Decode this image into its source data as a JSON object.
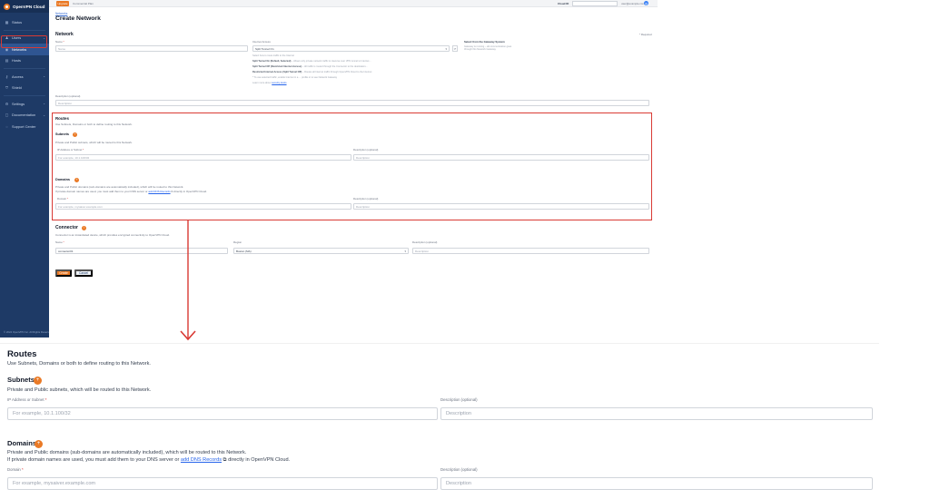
{
  "app": {
    "brand": "OpenVPN Cloud",
    "copyright": "© 2024 OpenVPN Inc. All Rights Reserved."
  },
  "topbar": {
    "upgrade_label": "Upgrade",
    "plan_text": "Commercial Plan",
    "cloud_id_label": "Cloud ID",
    "cloud_id_value": "",
    "user_email": "user@example.com"
  },
  "sidebar": {
    "items": [
      {
        "label": "Status",
        "icon": "status-icon",
        "glyph": "▦"
      },
      {
        "label": "Users",
        "icon": "users-icon",
        "glyph": "♟",
        "chevron": "⌄"
      },
      {
        "label": "Networks",
        "icon": "networks-icon",
        "glyph": "◉",
        "active": true
      },
      {
        "label": "Hosts",
        "icon": "hosts-icon",
        "glyph": "▤"
      },
      {
        "label": "Access",
        "icon": "access-icon",
        "glyph": "⚷",
        "chevron": "⌄"
      },
      {
        "label": "Shield",
        "icon": "shield-icon",
        "glyph": "⛉"
      },
      {
        "label": "Settings",
        "icon": "settings-icon",
        "glyph": "⚙",
        "chevron": "⌄"
      },
      {
        "label": "Documentation",
        "icon": "documentation-icon",
        "glyph": "▢",
        "chevron": "⌄"
      },
      {
        "label": "Support Center",
        "icon": "support-icon",
        "glyph": "◌"
      }
    ]
  },
  "page": {
    "breadcrumb": "Networks",
    "title": "Create Network",
    "required_note": "* Required",
    "network": {
      "heading": "Network",
      "name_label": "Name",
      "name_placeholder": "Name",
      "internet_access_label": "Internet Access",
      "internet_access_value": "Split Tunnel On",
      "internet_access_hint": "Select how to route traffic to the Internet",
      "hint_lines": [
        {
          "b": "Split Tunnel On (Default, Selected)",
          "t": " – Allows only private network traffic to traverse over VPN tunnel to Internet..."
        },
        {
          "b": "Split Tunnel Off (Restricted Internet Access)",
          "t": " – All traffic is routed through the Connector to the destination..."
        },
        {
          "b": "Restricted Internet Access (Split Tunnel Off)",
          "t": " – Routes all Internet traffic through OpenVPN Cloud to the Internet"
        }
      ],
      "hint_footer": "* To use selected traffic, enable Internet in a ... profile or to see Network Gateway",
      "learn_more": "Learn more about",
      "learn_link": "security levels",
      "gateway_title": "Select from the Gateway System",
      "gateway_text": "Gateway is running – all communication goes through this Network Gateway.",
      "description_label": "Description (optional)",
      "description_placeholder": "Description"
    },
    "routes": {
      "heading": "Routes",
      "intro": "Use Subnets, Domains or both to define routing to this Network.",
      "subnets": {
        "heading": "Subnets",
        "desc": "Private and Public subnets, which will be routed to this Network.",
        "ip_label": "IP Address or Subnet",
        "ip_placeholder": "For example, 10.1.100/32",
        "desc_label": "Description (optional)",
        "desc_placeholder": "Description"
      },
      "domains": {
        "heading": "Domains",
        "desc1": "Private and Public domains (sub-domains are automatically included), which will be routed to this Network.",
        "desc2_pre": "If private domain names are used, you must add them to your DNS server or",
        "desc2_link": "add DNS Records",
        "desc2_post": "directly in OpenVPN Cloud.",
        "domain_label": "Domain",
        "domain_placeholder": "For example, mysaiver.example.com",
        "desc_label": "Description (optional)",
        "desc_placeholder": "Description"
      }
    },
    "connector": {
      "heading": "Connector",
      "desc": "Connector is an instantiated device, which provides encrypted connectivity to OpenVPN Cloud.",
      "name_label": "Name",
      "name_value": "connector01",
      "region_label": "Region",
      "region_value": "Boston (MA)",
      "desc_label": "Description (optional)",
      "desc_placeholder": "Description"
    },
    "actions": {
      "create": "Create",
      "cancel": "Cancel"
    }
  },
  "zoom": {
    "heading": "Routes",
    "intro": "Use Subnets, Domains or both to define routing to this Network.",
    "subnets_heading": "Subnets",
    "subnets_desc": "Private and Public subnets, which will be routed to this Network.",
    "ip_label": "IP Address or Subnet",
    "ip_placeholder": "For example, 10.1.100/32",
    "desc_label": "Description (optional)",
    "desc_placeholder": "Description",
    "domains_heading": "Domains",
    "domains_desc1": "Private and Public domains (sub-domains are automatically included), which will be routed to this Network.",
    "domains_desc2_pre": "If private domain names are used, you must add them to your DNS server or",
    "domains_desc2_link": "add DNS Records",
    "domains_desc2_post": "directly in OpenVPN Cloud.",
    "domain_label": "Domain",
    "domain_placeholder": "For example, mysaiver.example.com",
    "badge": "+"
  },
  "colors": {
    "sidebar_bg": "#1e3a66",
    "accent_orange": "#ea7a26",
    "highlight_red": "#d93a34",
    "link_blue": "#2563eb"
  }
}
